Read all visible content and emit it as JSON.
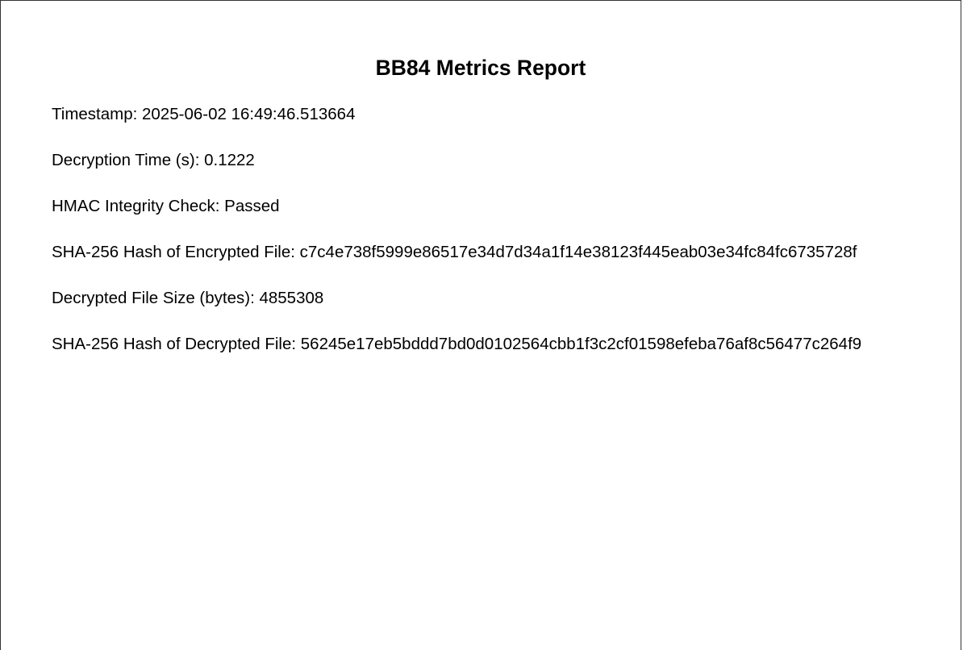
{
  "report": {
    "title": "BB84 Metrics Report",
    "lines": [
      "Timestamp: 2025-06-02 16:49:46.513664",
      "Decryption Time (s): 0.1222",
      "HMAC Integrity Check: Passed",
      "SHA-256 Hash of Encrypted File: c7c4e738f5999e86517e34d7d34a1f14e38123f445eab03e34fc84fc6735728f",
      "Decrypted File Size (bytes): 4855308",
      "SHA-256 Hash of Decrypted File: 56245e17eb5bddd7bd0d0102564cbb1f3c2cf01598efeba76af8c56477c264f9"
    ]
  }
}
